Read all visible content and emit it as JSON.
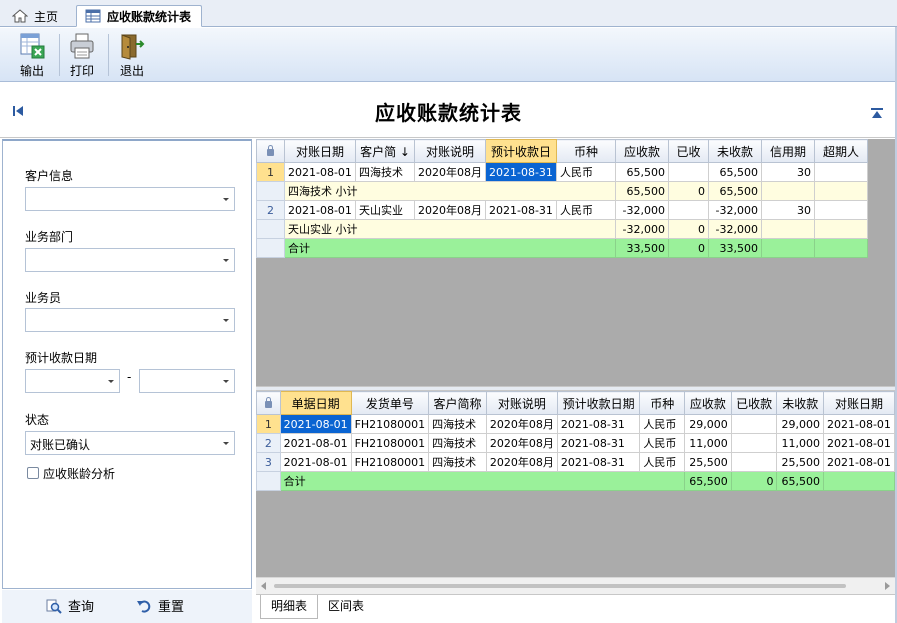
{
  "tabs": {
    "home": "主页",
    "active": "应收账款统计表"
  },
  "toolbar": {
    "export": "输出",
    "print": "打印",
    "exit": "退出"
  },
  "page_title": "应收账款统计表",
  "filters": {
    "customer_label": "客户信息",
    "customer_value": "",
    "dept_label": "业务部门",
    "dept_value": "",
    "salesman_label": "业务员",
    "salesman_value": "",
    "date_label": "预计收款日期",
    "date_from": "",
    "date_sep": "-",
    "date_to": "",
    "status_label": "状态",
    "status_value": "对账已确认",
    "aging_label": "应收账龄分析",
    "aging_checked": false
  },
  "footer": {
    "query": "查询",
    "reset": "重置"
  },
  "grid1": {
    "headers": [
      "对账日期",
      "客户简 ↓",
      "对账说明",
      "预计收款日",
      "币种",
      "应收款",
      "已收",
      "未收款",
      "信用期",
      "超期人"
    ],
    "rows": [
      {
        "type": "data",
        "rh": "1",
        "cells": [
          "2021-08-01",
          "四海技术",
          "2020年08月",
          "2021-08-31",
          "人民币",
          "65,500",
          "",
          "65,500",
          "30",
          ""
        ]
      },
      {
        "type": "sub",
        "rh": "",
        "label": "四海技术 小计",
        "cells": [
          "65,500",
          "0",
          "65,500",
          "",
          ""
        ]
      },
      {
        "type": "data",
        "rh": "2",
        "cells": [
          "2021-08-01",
          "天山实业",
          "2020年08月",
          "2021-08-31",
          "人民币",
          "-32,000",
          "",
          "-32,000",
          "30",
          ""
        ]
      },
      {
        "type": "sub",
        "rh": "",
        "label": "天山实业 小计",
        "cells": [
          "-32,000",
          "0",
          "-32,000",
          "",
          ""
        ]
      },
      {
        "type": "tot",
        "rh": "",
        "label": "合计",
        "cells": [
          "33,500",
          "0",
          "33,500",
          "",
          ""
        ]
      }
    ]
  },
  "grid2": {
    "headers": [
      "单据日期",
      "发货单号",
      "客户简称",
      "对账说明",
      "预计收款日期",
      "币种",
      "应收款",
      "已收款",
      "未收款",
      "对账日期"
    ],
    "rows": [
      {
        "type": "data",
        "rh": "1",
        "cells": [
          "2021-08-01",
          "FH21080001",
          "四海技术",
          "2020年08月",
          "2021-08-31",
          "人民币",
          "29,000",
          "",
          "29,000",
          "2021-08-01"
        ]
      },
      {
        "type": "data",
        "rh": "2",
        "cells": [
          "2021-08-01",
          "FH21080001",
          "四海技术",
          "2020年08月",
          "2021-08-31",
          "人民币",
          "11,000",
          "",
          "11,000",
          "2021-08-01"
        ]
      },
      {
        "type": "data",
        "rh": "3",
        "cells": [
          "2021-08-01",
          "FH21080001",
          "四海技术",
          "2020年08月",
          "2021-08-31",
          "人民币",
          "25,500",
          "",
          "25,500",
          "2021-08-01"
        ]
      },
      {
        "type": "tot",
        "rh": "",
        "label": "合计",
        "cells": [
          "65,500",
          "0",
          "65,500",
          ""
        ]
      }
    ]
  },
  "bottom_tabs": {
    "detail": "明细表",
    "range": "区间表"
  },
  "colors": {
    "accent": "#0a64d2",
    "total_row": "#9af19a",
    "subtotal_row": "#fffde0",
    "selected_header": "#ffe18f"
  }
}
